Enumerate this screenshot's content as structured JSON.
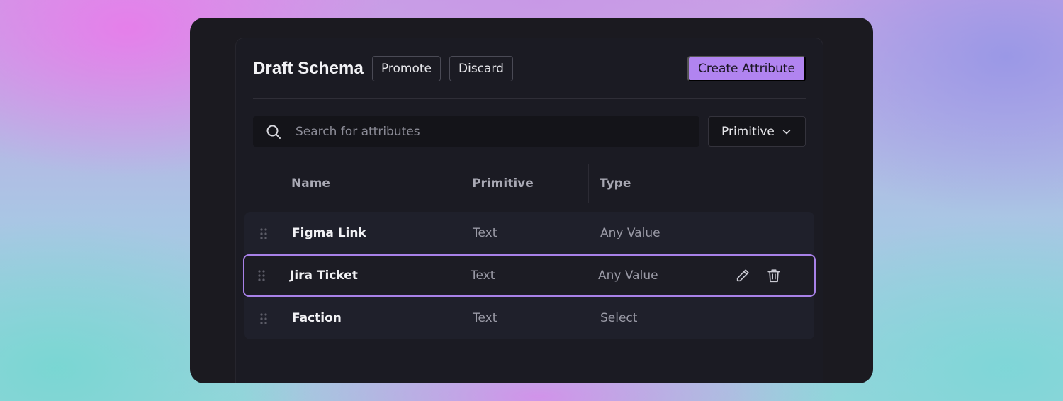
{
  "header": {
    "title": "Draft Schema",
    "promote_label": "Promote",
    "discard_label": "Discard",
    "create_label": "Create Attribute"
  },
  "search": {
    "placeholder": "Search for attributes",
    "icon": "search-icon"
  },
  "filter": {
    "selected": "Primitive",
    "icon": "chevron-down-icon"
  },
  "table": {
    "columns": [
      "Name",
      "Primitive",
      "Type"
    ],
    "rows": [
      {
        "name": "Figma Link",
        "primitive": "Text",
        "type": "Any Value",
        "selected": false
      },
      {
        "name": "Jira Ticket",
        "primitive": "Text",
        "type": "Any Value",
        "selected": true
      },
      {
        "name": "Faction",
        "primitive": "Text",
        "type": "Select",
        "selected": false
      }
    ],
    "row_actions": [
      "edit-icon",
      "trash-icon"
    ]
  },
  "colors": {
    "accent": "#b184f0",
    "selected_border": "#a881e8",
    "panel_bg": "#1b1b23",
    "row_bg": "#1f202b"
  }
}
